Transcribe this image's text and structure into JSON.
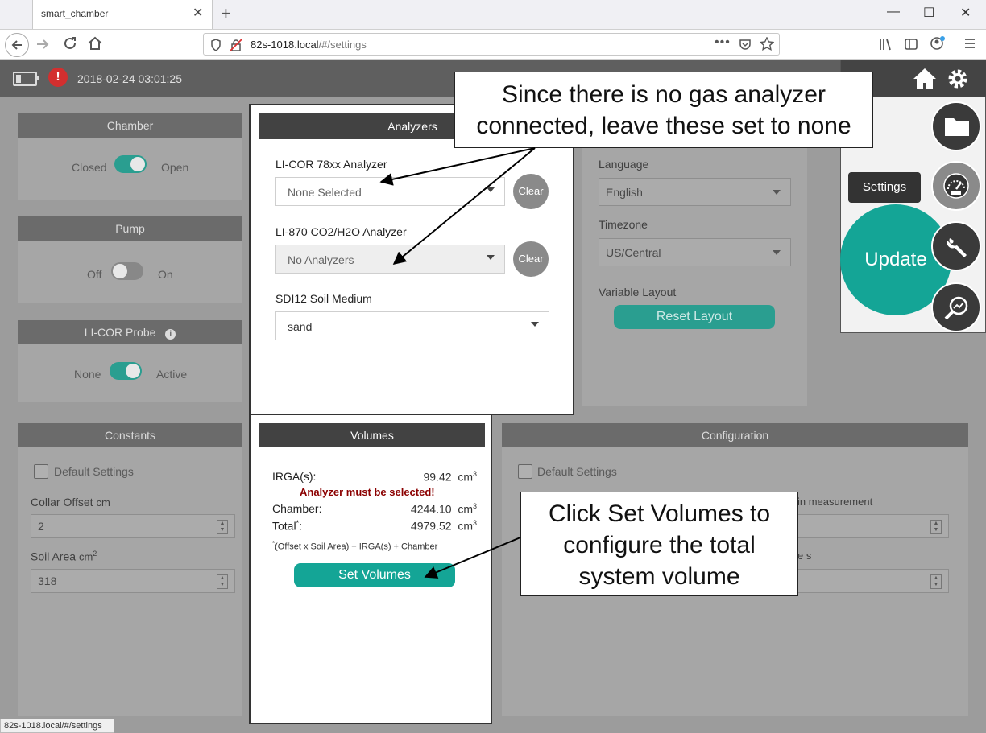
{
  "browser": {
    "tab_title": "smart_chamber",
    "tab_close": "✕",
    "new_tab": "+",
    "url_host": "82s-1018.local",
    "url_path": "/#/settings",
    "status_url": "82s-1018.local/#/settings",
    "window_controls": [
      "—",
      "☐",
      "✕"
    ]
  },
  "header": {
    "datetime": "2018-02-24 03:01:25",
    "alert_glyph": "!"
  },
  "chamber": {
    "title": "Chamber",
    "off_label": "Closed",
    "on_label": "Open",
    "state": "on"
  },
  "pump": {
    "title": "Pump",
    "off_label": "Off",
    "on_label": "On",
    "state": "off"
  },
  "probe": {
    "title": "LI-COR Probe",
    "off_label": "None",
    "on_label": "Active",
    "state": "on"
  },
  "constants": {
    "title": "Constants",
    "default_settings": "Default Settings",
    "collar_offset_label": "Collar Offset",
    "collar_offset_unit": "cm",
    "collar_offset_value": "2",
    "soil_area_label": "Soil Area",
    "soil_area_unit": "cm",
    "soil_area_sup": "2",
    "soil_area_value": "318"
  },
  "analyzers": {
    "title": "Analyzers",
    "licor78_label": "LI-COR 78xx Analyzer",
    "licor78_value": "None Selected",
    "li870_label": "LI-870 CO2/H2O Analyzer",
    "li870_value": "No Analyzers",
    "soil_label": "SDI12 Soil Medium",
    "soil_value": "sand",
    "clear_label": "Clear"
  },
  "general": {
    "language_label": "Language",
    "language_value": "English",
    "timezone_label": "Timezone",
    "timezone_value": "US/Central",
    "layout_label": "Variable Layout",
    "reset_layout": "Reset Layout"
  },
  "volumes": {
    "title": "Volumes",
    "irga_label": "IRGA(s):",
    "irga_value": "99.42",
    "warning": "Analyzer must be selected!",
    "chamber_label": "Chamber:",
    "chamber_value": "4244.10",
    "total_label": "Total",
    "total_sup": "*",
    "total_colon": ":",
    "total_value": "4979.52",
    "unit": "cm",
    "unit_sup": "3",
    "footnote_sup": "*",
    "footnote": "(Offset x Soil Area) + IRGA(s) + Chamber",
    "set_volumes": "Set Volumes"
  },
  "configuration": {
    "title": "Configuration",
    "default_settings": "Default Settings",
    "partial_label_1": "in measurement",
    "partial_label_2": "e s"
  },
  "menu": {
    "tooltip": "Settings",
    "update": "Update"
  },
  "annotations": {
    "top_line1": "Since there is no gas analyzer",
    "top_line2": "connected, leave these set to none",
    "bottom_line1": "Click Set Volumes to",
    "bottom_line2": "configure the total",
    "bottom_line3": "system volume"
  }
}
